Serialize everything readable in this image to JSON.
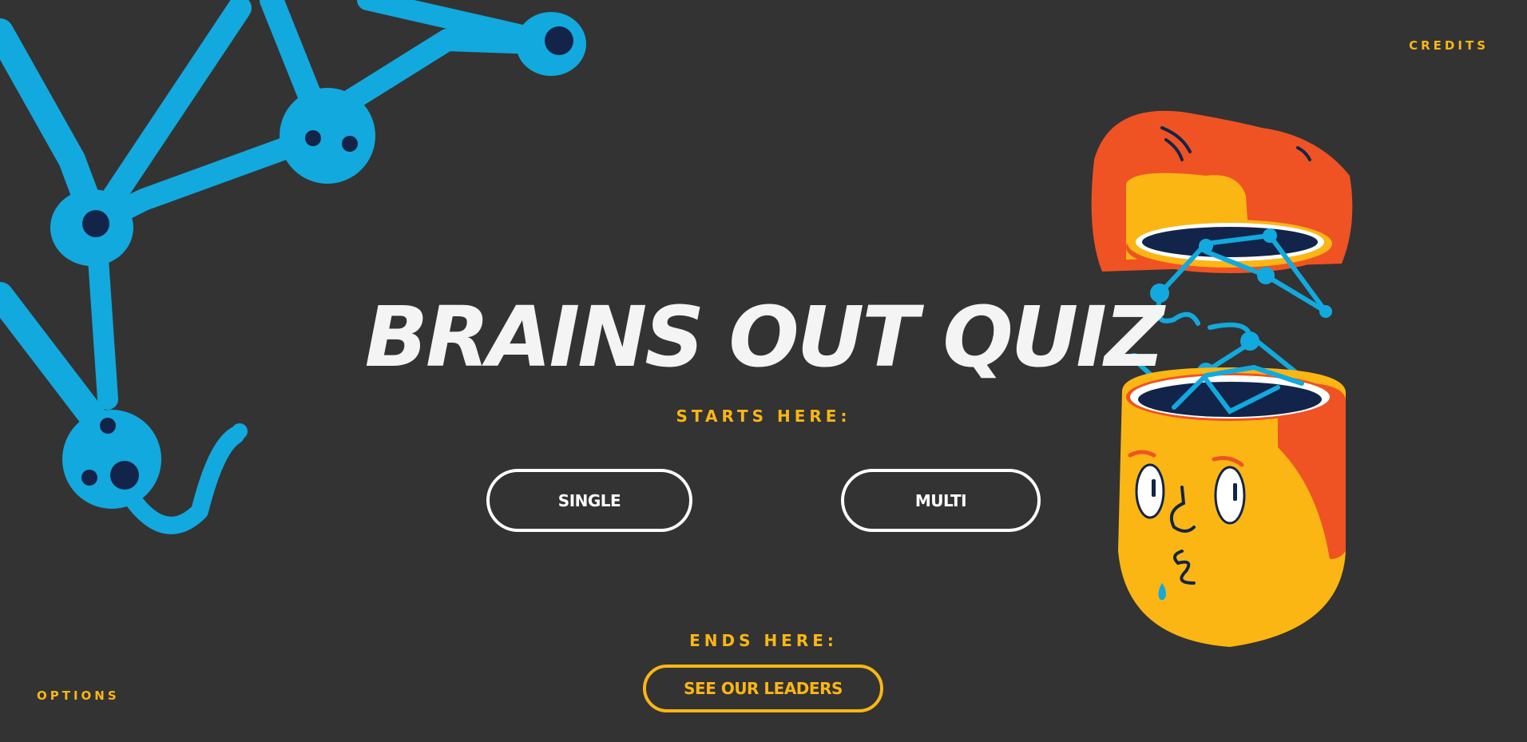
{
  "nav": {
    "credits": "CREDITS",
    "options": "OPTIONS"
  },
  "hero": {
    "title": "BRAINS OUT QUIZ",
    "starts_label": "STARTS HERE:",
    "ends_label": "ENDS HERE:"
  },
  "modes": {
    "single_label": "SINGLE",
    "multi_label": "MULTI"
  },
  "leaders": {
    "button_label": "SEE OUR LEADERS"
  },
  "colors": {
    "background": "#333333",
    "accent": "#FBB614",
    "text": "#F4F4F4",
    "neuron_blue": "#12A9DE",
    "hair_orange": "#EF5323",
    "navy": "#13244A"
  },
  "icons": {
    "neuron": "neuron-network-illustration",
    "head": "open-head-brain-illustration"
  }
}
